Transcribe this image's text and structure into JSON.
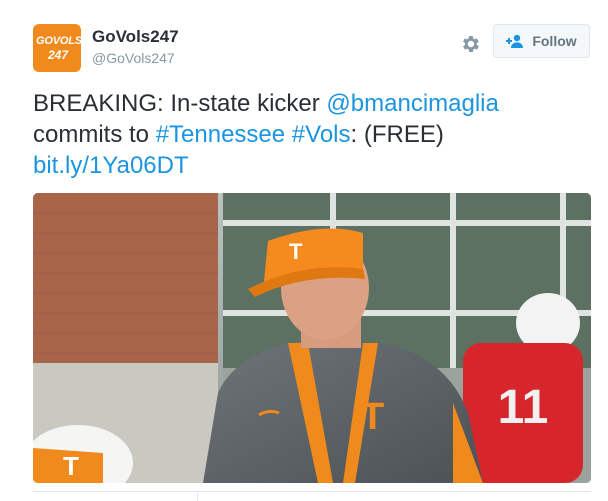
{
  "account": {
    "display_name": "GoVols247",
    "handle": "@GoVols247",
    "avatar_logo_top": "GOVOLS",
    "avatar_logo_bottom": "247"
  },
  "follow_button": {
    "label": "Follow",
    "icon": "add-user-icon"
  },
  "settings_icon": "gear-icon",
  "tweet": {
    "segments": [
      {
        "text": "BREAKING: In-state kicker ",
        "type": "text"
      },
      {
        "text": "@bmancimaglia",
        "type": "mention"
      },
      {
        "text": " commits to ",
        "type": "text"
      },
      {
        "text": "#Tennessee",
        "type": "hashtag"
      },
      {
        "text": " ",
        "type": "text"
      },
      {
        "text": "#Vols",
        "type": "hashtag"
      },
      {
        "text": ": (FREE) ",
        "type": "text"
      },
      {
        "text": "bit.ly/1Ya06DT",
        "type": "link"
      }
    ]
  },
  "media": {
    "visor_logo": "T",
    "jacket_logo": "T",
    "player_number": "11",
    "helmet_logo": "T"
  },
  "colors": {
    "link": "#1b95e0",
    "brand_orange": "#f08a1c",
    "text": "#292f33",
    "muted": "#8899a6"
  }
}
